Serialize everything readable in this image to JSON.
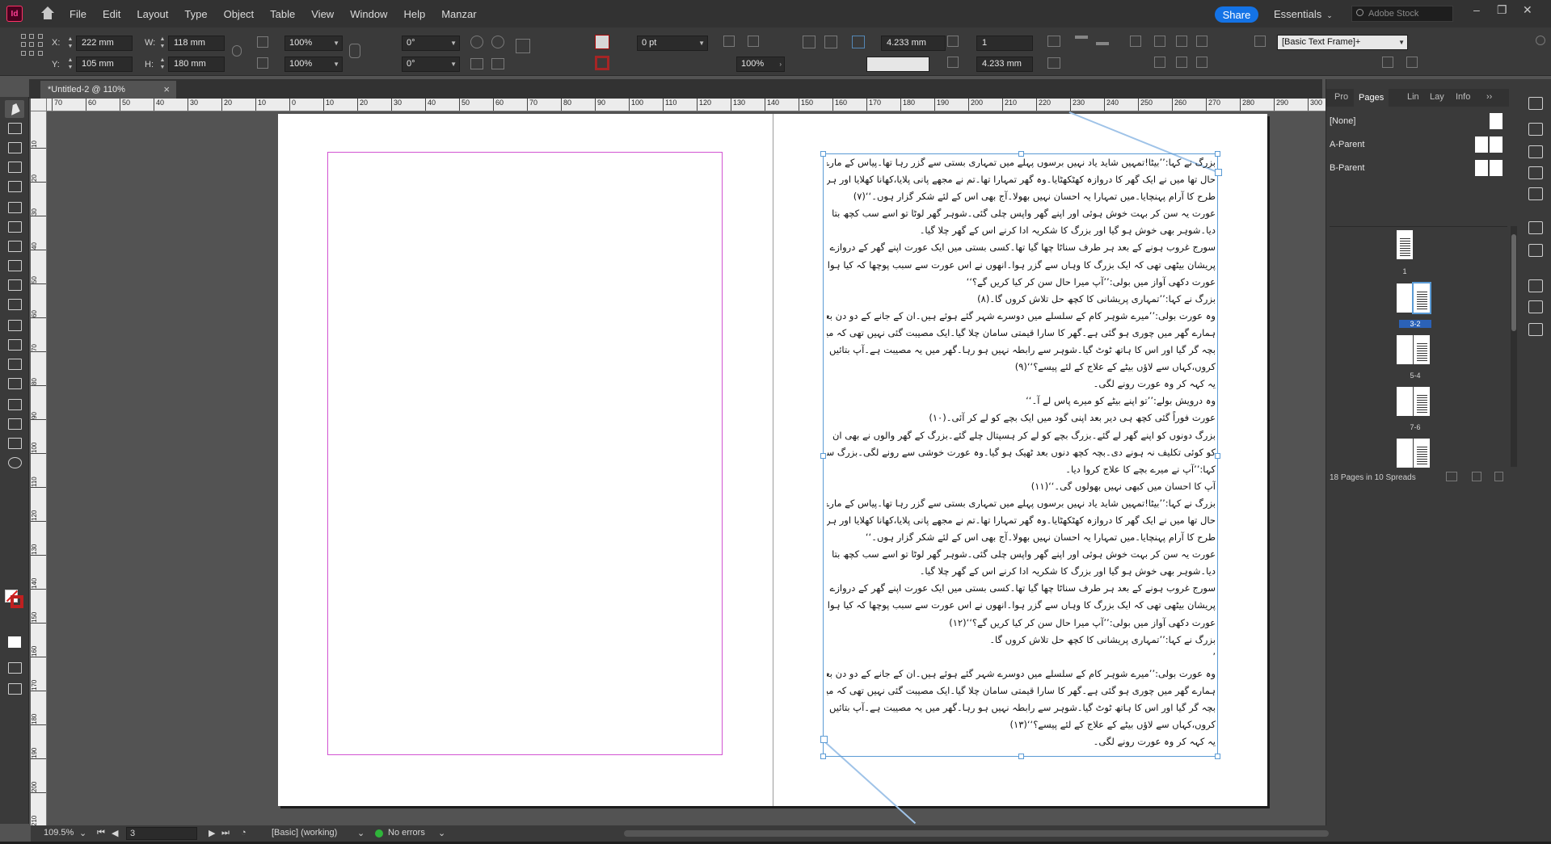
{
  "app": {
    "logo_text": "Id"
  },
  "menu": [
    "File",
    "Edit",
    "Layout",
    "Type",
    "Object",
    "Table",
    "View",
    "Window",
    "Help",
    "Manzar"
  ],
  "header": {
    "share_label": "Share",
    "workspace_label": "Essentials",
    "stock_placeholder": "Adobe Stock"
  },
  "control": {
    "x_label": "X:",
    "x_value": "222 mm",
    "y_label": "Y:",
    "y_value": "105 mm",
    "w_label": "W:",
    "w_value": "118 mm",
    "h_label": "H:",
    "h_value": "180 mm",
    "scale_x": "100%",
    "scale_y": "100%",
    "rotate": "0°",
    "shear": "0°",
    "stroke_weight": "0 pt",
    "opacity": "100%",
    "col_count": "1",
    "gutter_top": "4.233 mm",
    "gutter_bottom": "4.233 mm",
    "object_style": "[Basic Text Frame]+"
  },
  "document": {
    "tab_title": "*Untitled-2 @ 110%"
  },
  "ruler": {
    "top": [
      "70",
      "60",
      "50",
      "40",
      "30",
      "20",
      "10",
      "0",
      "10",
      "20",
      "30",
      "40",
      "50",
      "60",
      "70",
      "80",
      "90",
      "100",
      "110",
      "120",
      "130",
      "140",
      "150",
      "160",
      "170",
      "180",
      "190",
      "200",
      "210",
      "220",
      "230",
      "240",
      "250",
      "260",
      "270",
      "280",
      "290",
      "300",
      "310"
    ],
    "left": [
      "10",
      "20",
      "30",
      "40",
      "50",
      "60",
      "70",
      "80",
      "90",
      "100",
      "110",
      "120",
      "130",
      "140",
      "150",
      "160",
      "170",
      "180",
      "190",
      "200",
      "210"
    ]
  },
  "frame": {
    "lines": [
      "بزرگ نے کہا:’’بیٹا!تمہیں شاید یاد نہیں برسوں پہلے میں تمہاری بستی سے گزر رہا تھا۔پیاس کے مارے بُرا",
      "حال تھا میں نے ایک گھر کا دروازہ کھٹکھٹایا۔وہ گھر تمہارا تھا۔تم نے مجھے پانی پلایا،کھانا کھلایا اور ہر",
      "طرح کا آرام پہنچایا۔میں تمہارا یہ احسان نہیں بھولا۔آج بھی اس کے لئے شکر گزار ہوں۔‘‘(۷)",
      "عورت یہ سن کر بہت خوش ہوئی اور اپنے گھر واپس چلی گئی۔شوہر گھر لوٹا تو اسے سب کچھ بتا",
      "دیا۔شوہر بھی خوش ہو گیا اور بزرگ کا شکریہ ادا کرنے اس کے گھر چلا گیا۔",
      "سورج غروب ہونے کے بعد ہر طرف سناٹا چھا گیا تھا۔کسی بستی میں ایک عورت اپنے گھر کے دروازے پر",
      "پریشان بیٹھی تھی کہ ایک بزرگ کا وہاں سے گزر ہوا۔انھوں نے اس عورت سے سبب پوچھا کہ کیا ہوا تو وہ",
      "عورت دکھی آواز میں بولی:’’آپ میرا حال سن کر کیا کریں گے؟‘‘",
      "بزرگ نے کہا:’’تمہاری پریشانی کا کچھ حل تلاش کروں گا۔(۸)",
      "وہ عورت بولی:’’میرے شوہر کام کے سلسلے میں دوسرے شہر گئے ہوئے ہیں۔ان کے جانے کے دو دن بعد",
      "ہمارے گھر میں چوری ہو گئی ہے۔گھر کا سارا قیمتی سامان چلا گیا۔ایک مصیبت گئی نہیں تھی کہ میرا",
      "بچہ گر گیا اور اس کا ہاتھ ٹوٹ گیا۔شوہر سے رابطہ نہیں ہو رہا۔گھر میں یہ مصیبت ہے۔آپ بتائیں کیا",
      "کروں،کہاں سے لاؤں بیٹے کے علاج کے لئے پیسے؟‘‘(۹)",
      "یہ کہہ کر وہ عورت رونے لگی۔",
      "وہ درویش بولے:’’تو اپنے بیٹے کو میرے پاس لے آ۔‘‘",
      "عورت فوراً گئی کچھ ہی دیر بعد اپنی گود میں ایک بچے کو لے کر آئی۔(۱۰)",
      "بزرگ دونوں کو اپنے گھر لے گئے۔بزرگ بچے کو لے کر ہسپتال چلے گئے۔بزرگ کے گھر والوں نے بھی ان",
      "کو کوئی تکلیف نہ ہونے دی۔بچہ کچھ دنوں بعد ٹھیک ہو گیا۔وہ عورت خوشی سے رونے لگی۔بزرگ سے",
      "کہا:’’آپ نے میرے بچے کا علاج کروا دیا۔",
      "آپ کا احسان میں کبھی نہیں بھولوں گی۔‘‘(۱۱)",
      "بزرگ نے کہا:’’بیٹا!تمہیں شاید یاد نہیں برسوں پہلے میں تمہاری بستی سے گزر رہا تھا۔پیاس کے مارے بُرا",
      "حال تھا میں نے ایک گھر کا دروازہ کھٹکھٹایا۔وہ گھر تمہارا تھا۔تم نے مجھے پانی پلایا،کھانا کھلایا اور ہر",
      "طرح کا آرام پہنچایا۔میں تمہارا یہ احسان نہیں بھولا۔آج بھی اس کے لئے شکر گزار ہوں۔‘‘",
      "عورت یہ سن کر بہت خوش ہوئی اور اپنے گھر واپس چلی گئی۔شوہر گھر لوٹا تو اسے سب کچھ بتا",
      "دیا۔شوہر بھی خوش ہو گیا اور بزرگ کا شکریہ ادا کرنے اس کے گھر چلا گیا۔",
      "سورج غروب ہونے کے بعد ہر طرف سناٹا چھا گیا تھا۔کسی بستی میں ایک عورت اپنے گھر کے دروازے پر",
      "پریشان بیٹھی تھی کہ ایک بزرگ کا وہاں سے گزر ہوا۔انھوں نے اس عورت سے سبب پوچھا کہ کیا ہوا تو وہ",
      "عورت دکھی آواز میں بولی:’’آپ میرا حال سن کر کیا کریں گے؟‘‘(۱۲)",
      "بزرگ نے کہا:’’تمہاری پریشانی کا کچھ حل تلاش کروں گا۔",
      "’",
      "وہ عورت بولی:’’میرے شوہر کام کے سلسلے میں دوسرے شہر گئے ہوئے ہیں۔ان کے جانے کے دو دن بعد",
      "ہمارے گھر میں چوری ہو گئی ہے۔گھر کا سارا قیمتی سامان چلا گیا۔ایک مصیبت گئی نہیں تھی کہ میرا",
      "بچہ گر گیا اور اس کا ہاتھ ٹوٹ گیا۔شوہر سے رابطہ نہیں ہو رہا۔گھر میں یہ مصیبت ہے۔آپ بتائیں کیا",
      "کروں،کہاں سے لاؤں بیٹے کے علاج کے لئے پیسے؟‘‘(۱۳)",
      "یہ کہہ کر وہ عورت رونے لگی۔"
    ]
  },
  "pages_panel": {
    "tabs": [
      "Pro",
      "Pages",
      "Lin",
      "Lay",
      "Info"
    ],
    "parents": [
      "[None]",
      "A-Parent",
      "B-Parent"
    ],
    "thumb_labels": [
      "1",
      "3-2",
      "5-4",
      "7-6"
    ],
    "footer": "18 Pages in 10 Spreads"
  },
  "status": {
    "zoom": "109.5%",
    "page": "3",
    "style": "[Basic] (working)",
    "preflight": "No errors"
  }
}
